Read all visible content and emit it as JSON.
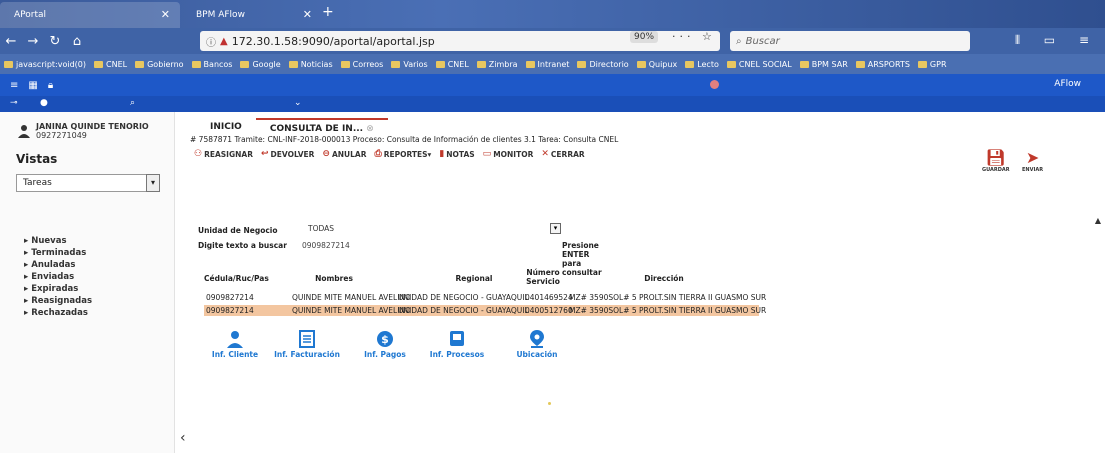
{
  "browser": {
    "tabs": [
      {
        "label": "APortal"
      },
      {
        "label": "BPM AFlow"
      }
    ],
    "url": "172.30.1.58:9090/aportal/aportal.jsp",
    "zoom": "90%",
    "search_placeholder": "Buscar",
    "bookmarks": [
      "javascript:void(0)",
      "CNEL",
      "Gobierno",
      "Bancos",
      "Google",
      "Noticias",
      "Correos",
      "Varios",
      "CNEL",
      "Zimbra",
      "Intranet",
      "Directorio",
      "Quipux",
      "Lecto",
      "CNEL SOCIAL",
      "BPM SAR",
      "ARSPORTS",
      "GPR"
    ]
  },
  "app": {
    "name": "AFlow"
  },
  "sidebar": {
    "user_name": "JANINA QUINDE TENORIO",
    "user_id": "0927271049",
    "vistas_title": "Vistas",
    "tareas_value": "Tareas",
    "views": [
      "Nuevas",
      "Terminadas",
      "Anuladas",
      "Enviadas",
      "Expiradas",
      "Reasignadas",
      "Rechazadas"
    ]
  },
  "main": {
    "tabs": [
      "INICIO",
      "CONSULTA DE IN..."
    ],
    "crumb": "# 7587871 Tramite: CNL-INF-2018-000013 Proceso: Consulta de Información de clientes 3.1 Tarea: Consulta CNEL",
    "toolbar": [
      "REASIGNAR",
      "DEVOLVER",
      "ANULAR",
      "REPORTES▾",
      "NOTAS",
      "MONITOR",
      "CERRAR"
    ],
    "save_label": "GUARDAR",
    "send_label": "ENVIAR"
  },
  "form": {
    "unidad_label": "Unidad de Negocio",
    "unidad_value": "TODAS",
    "digite_label": "Digite texto a buscar",
    "search_value": "0909827214",
    "hint": "Presione ENTER para consultar"
  },
  "table": {
    "headers": [
      "Cédula/Ruc/Pas",
      "Nombres",
      "Regional",
      "Número Servicio",
      "Dirección"
    ],
    "rows": [
      [
        "0909827214",
        "QUINDE MITE MANUEL AVELINO",
        "UNIDAD DE NEGOCIO - GUAYAQUIL",
        "0401469524",
        "MZ# 3590SOL# 5 PROLT.SIN TIERRA II GUASMO SUR"
      ],
      [
        "0909827214",
        "QUINDE MITE MANUEL AVELINO",
        "UNIDAD DE NEGOCIO - GUAYAQUIL",
        "0400512760",
        "MZ# 3590SOL# 5 PROLT.SIN TIERRA II GUASMO SUR"
      ]
    ],
    "selected_row": 1,
    "selected_color": "#f3c6a0"
  },
  "actions": [
    {
      "label": "Inf. Cliente",
      "icon": "user-icon"
    },
    {
      "label": "Inf. Facturación",
      "icon": "document-icon"
    },
    {
      "label": "Inf. Pagos",
      "icon": "dollar-icon"
    },
    {
      "label": "Inf. Procesos",
      "icon": "process-icon"
    },
    {
      "label": "Ubicación",
      "icon": "location-icon"
    }
  ],
  "colors": {
    "header_blue": "#1e58c8",
    "accent_red": "#c0392b",
    "action_blue": "#1f78d1"
  }
}
